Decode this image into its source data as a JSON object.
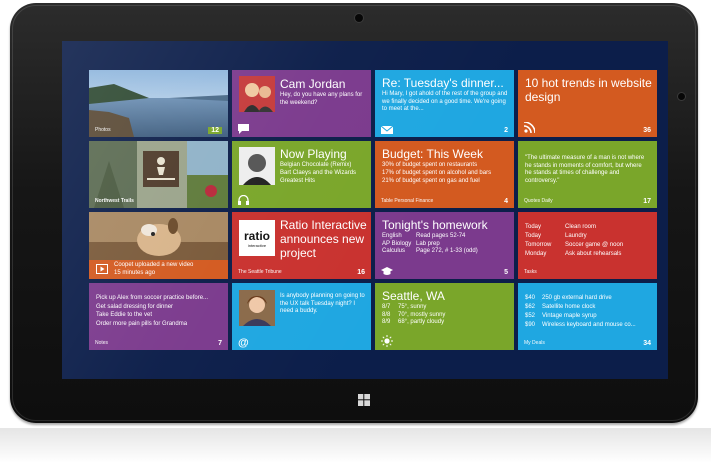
{
  "tiles": {
    "photos": {
      "label": "Photos",
      "badge": "12"
    },
    "cam": {
      "title": "Cam Jordan",
      "body": "Hey, do you have any plans for the weekend?"
    },
    "mail": {
      "title": "Re: Tuesday's dinner...",
      "body": "Hi  Mary,  I got ahold of the rest of the group and we finally decided on a good time. We're going to meet at the...",
      "badge": "2"
    },
    "news": {
      "title": "10 hot trends in website design",
      "badge": "36"
    },
    "trails": {
      "label": "Northwest Trails"
    },
    "nowplaying": {
      "title": "Now Playing",
      "line1": "Belgian Chocolate (Remix)",
      "line2": "Bart Claeys and the Wizards",
      "line3": "Greatest Hits"
    },
    "budget": {
      "title": "Budget: This Week",
      "line1": "30% of budget spent on restaurants",
      "line2": "17% of budget spent on alcohol and bars",
      "line3": "21% of budget spent on gas and fuel",
      "brand": "Table Personal Finance",
      "badge": "4"
    },
    "quote": {
      "body": "\"The ultimate measure of a man is not where he stands in moments of comfort, but where he stands at times of challenge and controversy.\"",
      "brand": "Quotes Daily",
      "badge": "17"
    },
    "video": {
      "line1": "Coopet uploaded a new video",
      "line2": "15 minutes ago"
    },
    "ratio": {
      "logo_text": "ratio",
      "logo_sub": "interactive",
      "title": "Ratio Interactive announces new project",
      "brand": "The Seattle Tribune",
      "badge": "16"
    },
    "homework": {
      "title": "Tonight's homework",
      "rows": [
        [
          "English",
          "Read pages 52-74"
        ],
        [
          "AP Biology",
          "Lab prep"
        ],
        [
          "Calculus",
          "Page 272, # 1-33 (odd)"
        ]
      ],
      "badge": "5"
    },
    "tasks": {
      "rows": [
        [
          "Today",
          "Clean room"
        ],
        [
          "Today",
          "Laundry"
        ],
        [
          "Tomorrow",
          "Soccer game @ noon"
        ],
        [
          "Monday",
          "Ask about rehearsals"
        ]
      ],
      "brand": "Tasks"
    },
    "notes": {
      "lines": [
        "Pick up Alex from soccer practice before...",
        "Get salad dressing for dinner",
        "Take Eddie to the vet",
        "Order more pain pills for Grandma"
      ],
      "brand": "Notes",
      "badge": "7"
    },
    "social": {
      "body": "Is anybody planning on going to the UX talk Tuesday night? I need a buddy."
    },
    "weather": {
      "title": "Seattle, WA",
      "rows": [
        [
          "8/7",
          "75°, sunny"
        ],
        [
          "8/8",
          "70°, mostly sunny"
        ],
        [
          "8/9",
          "68°, partly cloudy"
        ]
      ]
    },
    "deals": {
      "rows": [
        [
          "$40",
          "250 gb external hard drive"
        ],
        [
          "$62",
          "Satellite home clock"
        ],
        [
          "$52",
          "Vintage maple syrup"
        ],
        [
          "$90",
          "Wireless keyboard and mouse co..."
        ]
      ],
      "brand": "My Deals",
      "badge": "34"
    }
  },
  "colors": {
    "purple": "#7b3a8d",
    "blue": "#1fa7e1",
    "orange": "#d35a20",
    "green": "#7aa62a",
    "red": "#c9322f",
    "dark_purple": "#6a2f8a"
  }
}
